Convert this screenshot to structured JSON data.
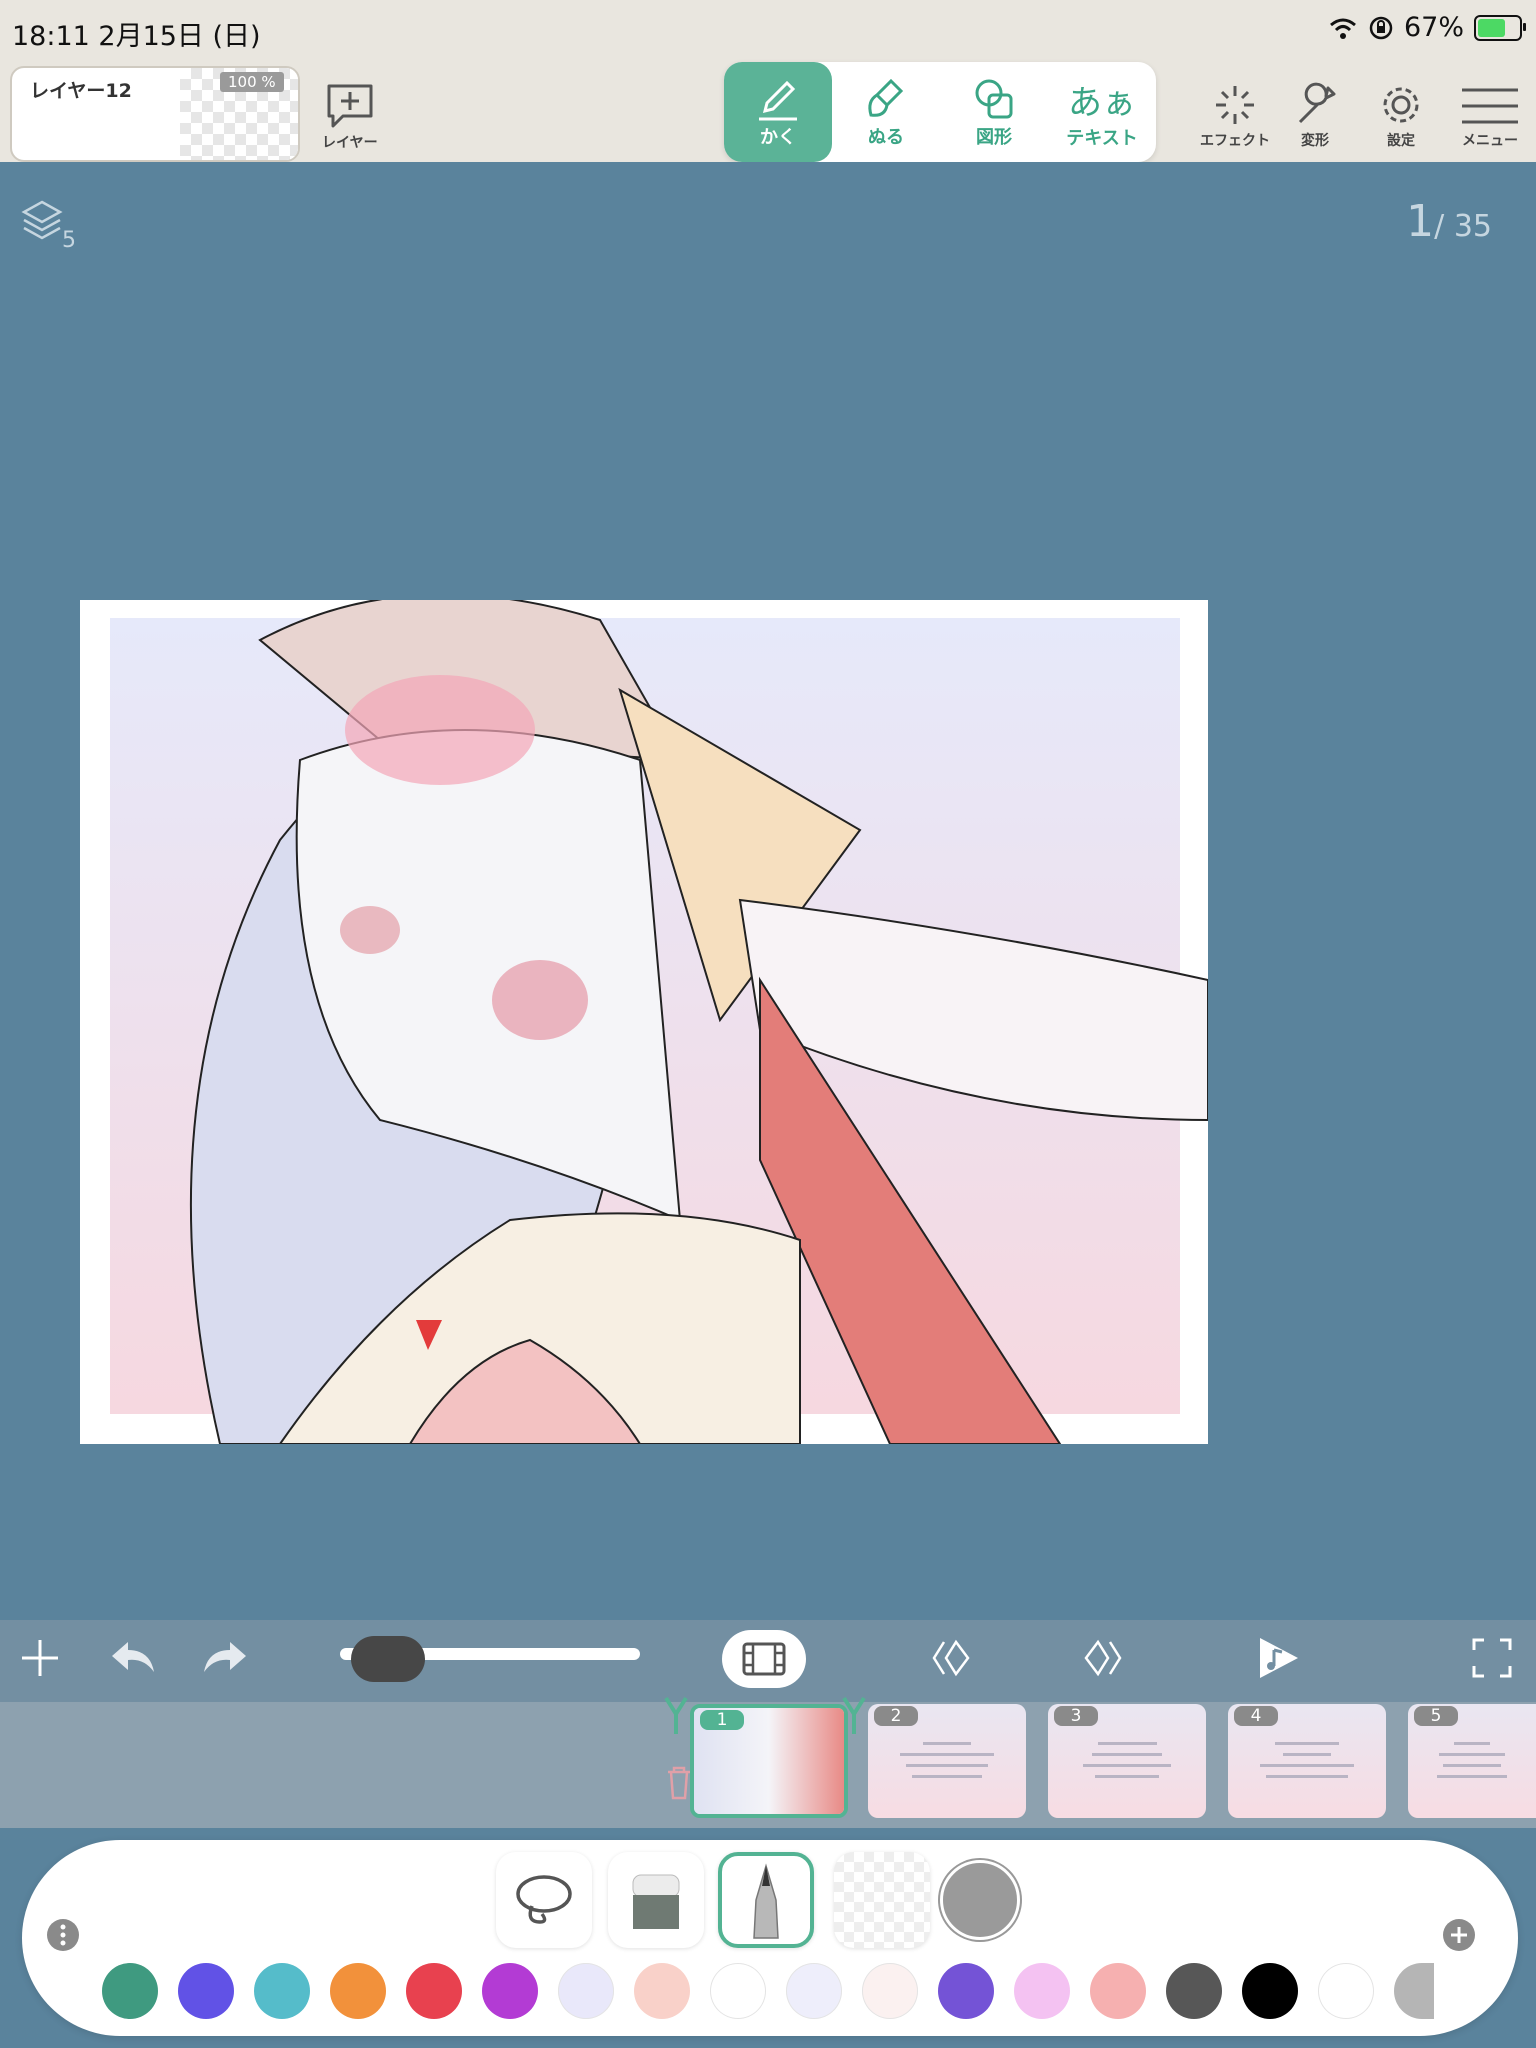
{
  "status": {
    "time_date": "18:11   2月15日 (日)",
    "battery": "67%"
  },
  "layer": {
    "name": "レイヤー12",
    "opacity": "100 %"
  },
  "toolbar": {
    "add_layer_label": "レイヤー",
    "tools": [
      {
        "label": "かく",
        "icon": "pencil-icon",
        "active": true
      },
      {
        "label": "ぬる",
        "icon": "brush-icon",
        "active": false
      },
      {
        "label": "図形",
        "icon": "shape-icon",
        "active": false
      },
      {
        "label": "テキスト",
        "icon": "text-icon",
        "active": false
      }
    ],
    "effect_label": "エフェクト",
    "transform_label": "変形",
    "settings_label": "設定",
    "menu_label": "メニュー"
  },
  "canvas": {
    "layer_count": "5",
    "page_current": "1",
    "page_total": "/ 35"
  },
  "timeline": {
    "progress": 0.05,
    "frames": [
      {
        "num": "1",
        "selected": true
      },
      {
        "num": "2",
        "selected": false
      },
      {
        "num": "3",
        "selected": false
      },
      {
        "num": "4",
        "selected": false
      },
      {
        "num": "5",
        "selected": false
      }
    ]
  },
  "palette": {
    "colors": [
      "#3f9a80",
      "#6152e6",
      "#55bcca",
      "#f2913b",
      "#e8414f",
      "#b33bd4",
      "#e9e8fa",
      "#f9d1c9",
      "#ffffff",
      "#eeeefb",
      "#fbf1f0",
      "#7453d6",
      "#f4c2f2",
      "#f6b0b0",
      "#575757",
      "#000000",
      "#ffffff",
      "#b5b5b5"
    ],
    "selected_color": "#9a9a9a",
    "accent": "#53b393"
  }
}
